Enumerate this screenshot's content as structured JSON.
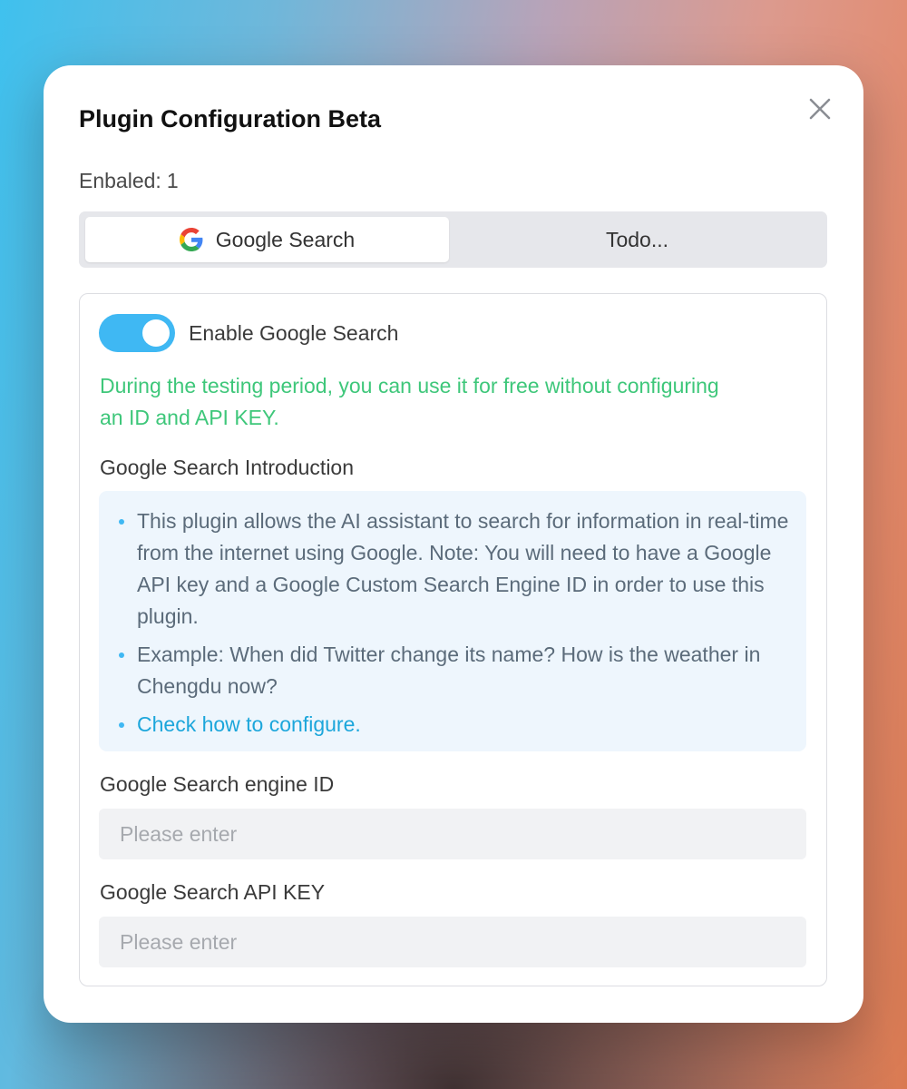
{
  "dialog": {
    "title": "Plugin Configuration Beta",
    "enabled_label": "Enbaled:",
    "enabled_count": "1",
    "close_icon": "close-icon"
  },
  "tabs": [
    {
      "label": "Google Search",
      "icon": "google-g-icon",
      "active": true
    },
    {
      "label": "Todo...",
      "active": false
    }
  ],
  "plugin": {
    "toggle_label": "Enable Google Search",
    "toggle_on": true,
    "free_note": "During the testing period, you can use it for free without configuring an ID and API KEY.",
    "intro_title": "Google Search Introduction",
    "intro_items": [
      "This plugin allows the AI assistant to search for information in real-time from the internet using Google. Note: You will need to have a Google API key and a Google Custom Search Engine ID in order to use this plugin.",
      "Example: When did Twitter change its name? How is the weather in Chengdu now?",
      "Check how to configure."
    ],
    "engine_id_label": "Google Search engine ID",
    "engine_id_placeholder": "Please enter",
    "engine_id_value": "",
    "api_key_label": "Google Search API KEY",
    "api_key_placeholder": "Please enter",
    "api_key_value": ""
  },
  "colors": {
    "accent": "#3fb8f3",
    "note_green": "#3ec77a",
    "link_blue": "#1ca6db"
  }
}
